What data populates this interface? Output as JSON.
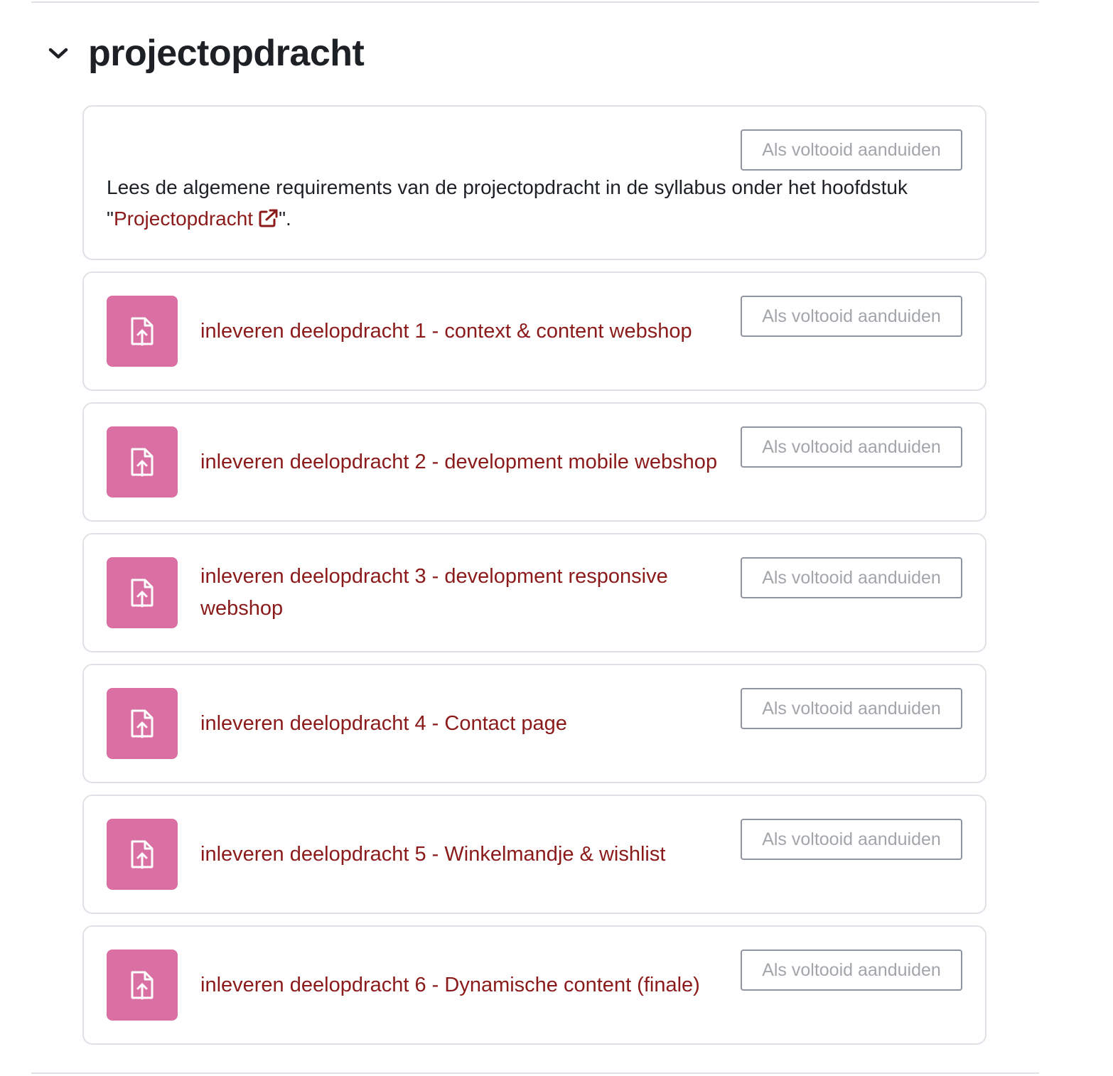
{
  "section": {
    "title": "projectopdracht",
    "toggle_icon": "chevron-down-icon"
  },
  "intro": {
    "text_before": "Lees de algemene requirements van de projectopdracht in de syllabus onder het hoofdstuk \"",
    "link_text": "Projectopdracht",
    "text_after": "\".",
    "link_icon": "external-link-icon",
    "complete_label": "Als voltooid aanduiden"
  },
  "activities": [
    {
      "name": "inleveren deelopdracht 1 - context & content webshop",
      "icon": "assignment-upload-icon",
      "complete_label": "Als voltooid aanduiden"
    },
    {
      "name": "inleveren deelopdracht 2 - development mobile webshop",
      "icon": "assignment-upload-icon",
      "complete_label": "Als voltooid aanduiden"
    },
    {
      "name": "inleveren deelopdracht 3 - development responsive webshop",
      "icon": "assignment-upload-icon",
      "complete_label": "Als voltooid aanduiden"
    },
    {
      "name": "inleveren deelopdracht 4 - Contact page",
      "icon": "assignment-upload-icon",
      "complete_label": "Als voltooid aanduiden"
    },
    {
      "name": "inleveren deelopdracht 5 - Winkelmandje & wishlist",
      "icon": "assignment-upload-icon",
      "complete_label": "Als voltooid aanduiden"
    },
    {
      "name": "inleveren deelopdracht 6 - Dynamische content (finale)",
      "icon": "assignment-upload-icon",
      "complete_label": "Als voltooid aanduiden"
    }
  ],
  "colors": {
    "link": "#8b1a1a",
    "activity_icon_bg": "#d96fa2",
    "border": "#dee2e6",
    "button_text": "#a2a6ab"
  }
}
